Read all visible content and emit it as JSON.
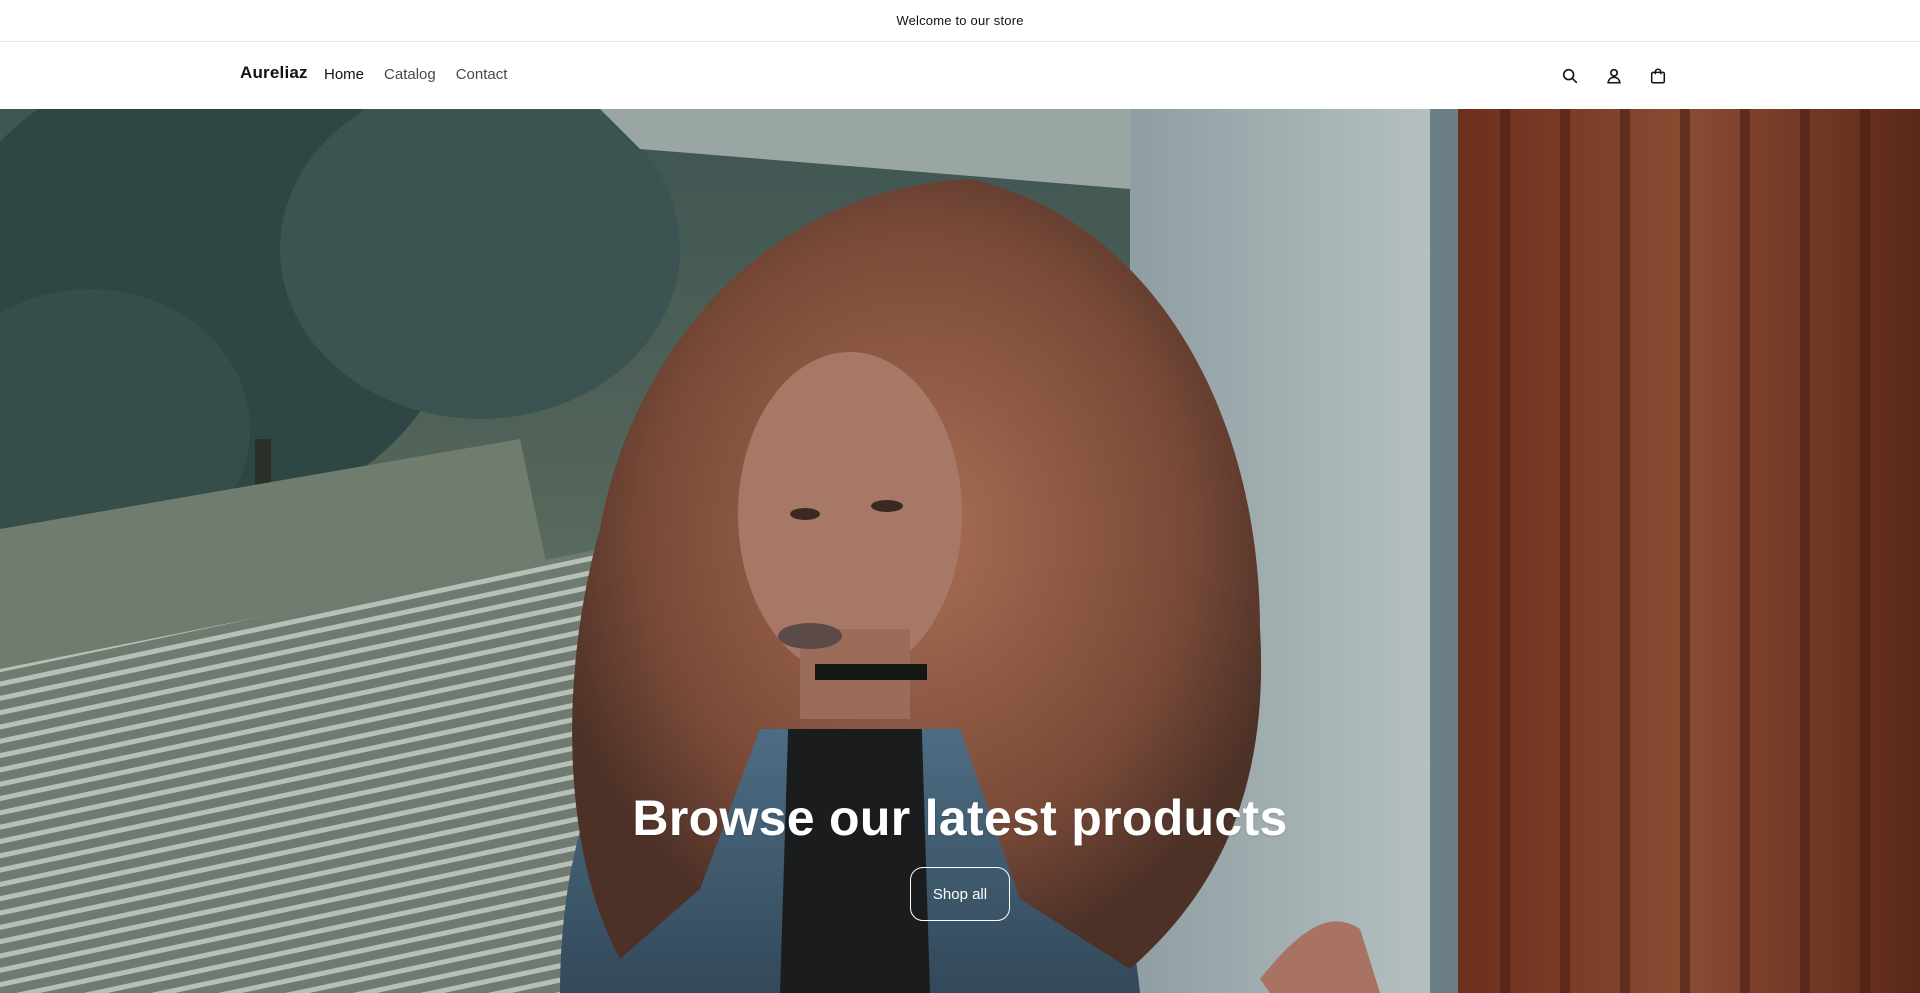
{
  "announcement": {
    "text": "Welcome to our store"
  },
  "header": {
    "logo": "Aureliaz",
    "nav": [
      {
        "label": "Home"
      },
      {
        "label": "Catalog"
      },
      {
        "label": "Contact"
      }
    ],
    "icons": [
      "search-icon",
      "account-icon",
      "cart-icon"
    ]
  },
  "hero": {
    "title": "Browse our latest products",
    "button_label": "Shop all",
    "image_description_icon": "hero-photo"
  },
  "colors": {
    "text": "#121212",
    "background": "#ffffff",
    "hero_text": "#ffffff"
  }
}
